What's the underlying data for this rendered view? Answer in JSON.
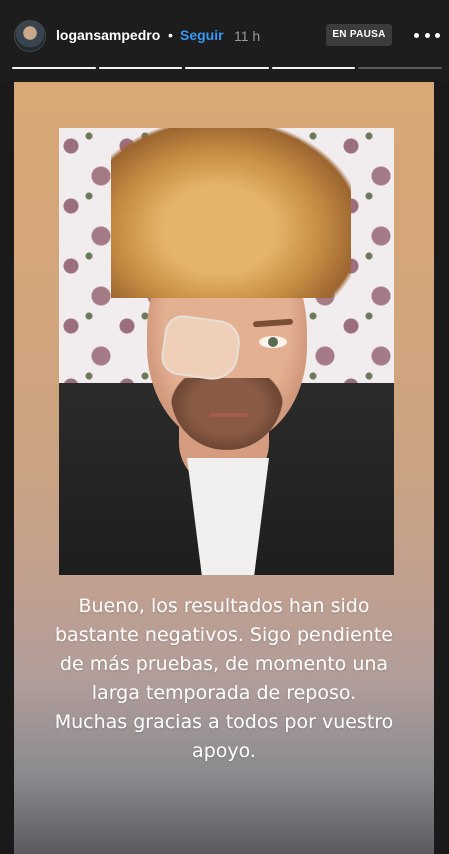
{
  "header": {
    "username": "logansampedro",
    "separator": "•",
    "follow_label": "Seguir",
    "time": "11 h",
    "paused_label": "EN PAUSA",
    "more_icon": "more-horizontal-icon"
  },
  "progress": {
    "segments": [
      1,
      1,
      1,
      1,
      0
    ]
  },
  "story": {
    "caption": "Bueno, los resultados han sido bastante negativos. Sigo pendiente de más pruebas, de momento una larga temporada de reposo. Muchas gracias a todos por vuestro apoyo."
  },
  "colors": {
    "follow": "#3897f0",
    "background": "#1a1a1a",
    "story_gradient_top": "#d8a877",
    "story_gradient_bottom": "#5a5a60"
  }
}
